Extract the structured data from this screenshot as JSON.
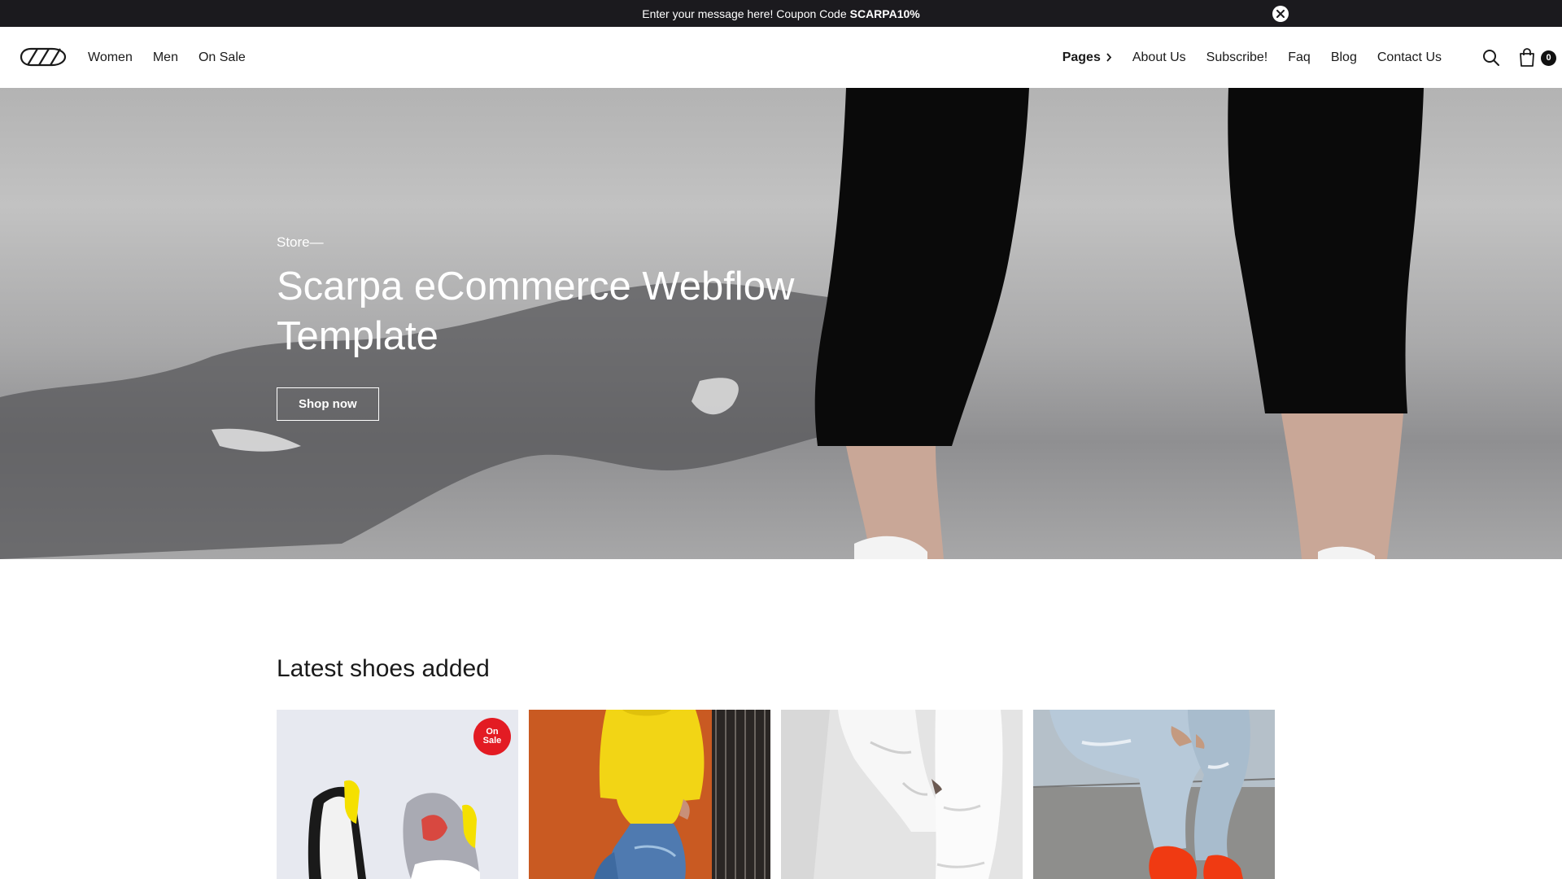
{
  "announcement": {
    "message": "Enter your message here! Coupon Code",
    "code": "SCARPA10%"
  },
  "nav": {
    "left": [
      "Women",
      "Men",
      "On Sale"
    ],
    "pages_label": "Pages",
    "right": [
      "About Us",
      "Subscribe!",
      "Faq",
      "Blog",
      "Contact Us"
    ],
    "cart_count": "0"
  },
  "icons": {
    "close": "close-icon",
    "search": "search-icon",
    "cart": "bag-icon",
    "pages_chevron": "chevron-right-icon"
  },
  "hero": {
    "eyebrow": "Store—",
    "title": "Scarpa eCommerce Webflow Template",
    "button": "Shop now"
  },
  "latest": {
    "title": "Latest shoes added",
    "products": [
      {
        "badge_line1": "On",
        "badge_line2": "Sale"
      },
      {},
      {},
      {}
    ]
  },
  "colors": {
    "announce_bg": "#1b1a1e",
    "badge": "#e31b23",
    "accent_text": "#1a1a1a"
  }
}
